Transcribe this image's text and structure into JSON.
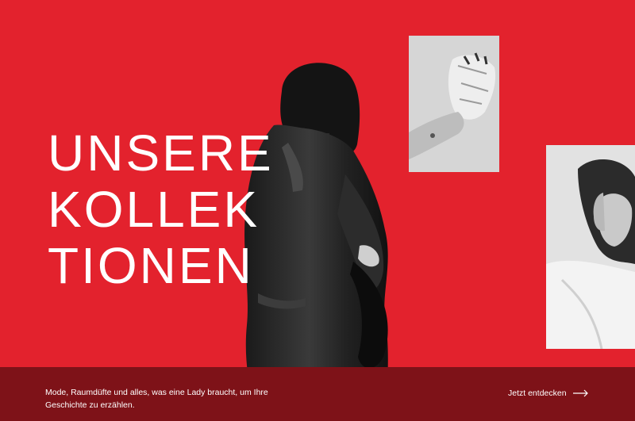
{
  "hero": {
    "headline_lines": [
      "UNSERE",
      "KOLLEK",
      "TIONEN"
    ],
    "background_color": "#e3222d",
    "band_color": "#7e1218"
  },
  "images": {
    "hand": "hand-with-crumpled-foil-photo",
    "woman": "woman-portrait-photo",
    "model": "model-in-leather-coat-photo"
  },
  "footer_band": {
    "description": "Mode, Raumdüfte und alles, was eine Lady braucht, um Ihre Geschichte zu erzählen.",
    "cta_label": "Jetzt entdecken",
    "cta_icon": "arrow-right-icon"
  }
}
